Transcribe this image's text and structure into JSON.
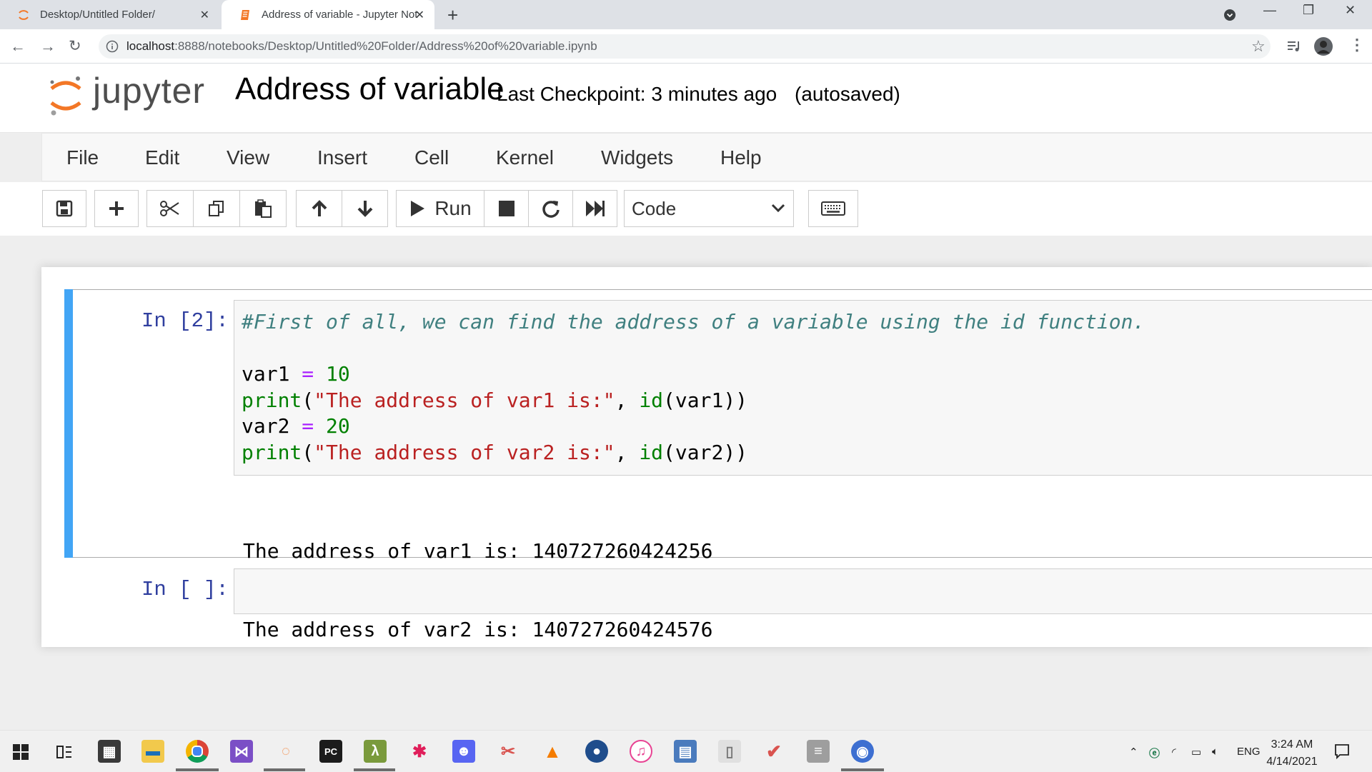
{
  "browser": {
    "tabs": [
      {
        "title": "Desktop/Untitled Folder/",
        "icon": "jupyter-spinner-icon",
        "active": false
      },
      {
        "title": "Address of variable - Jupyter Not",
        "icon": "notebook-icon",
        "active": true
      }
    ],
    "new_tab_label": "+",
    "url_host": "localhost",
    "url_path": ":8888/notebooks/Desktop/Untitled%20Folder/Address%20of%20variable.ipynb",
    "window_controls": {
      "minimize": "—",
      "restore": "❐",
      "close": "✕"
    }
  },
  "jupyter": {
    "logo_text": "jupyter",
    "notebook_title": "Address of variable",
    "checkpoint": "Last Checkpoint: 3 minutes ago",
    "autosave": "(autosaved)",
    "menu": [
      "File",
      "Edit",
      "View",
      "Insert",
      "Cell",
      "Kernel",
      "Widgets",
      "Help"
    ],
    "toolbar": {
      "run_label": "Run",
      "cell_type": "Code",
      "cell_type_options": [
        "Code"
      ]
    },
    "cells": [
      {
        "prompt": "In [2]:",
        "code_lines": [
          "#First of all, we can find the address of a variable using the id function.",
          "",
          "var1 = 10",
          "print(\"The address of var1 is:\", id(var1))",
          "var2 = 20",
          "print(\"The address of var2 is:\", id(var2))"
        ],
        "output_lines": [
          "The address of var1 is: 140727260424256",
          "The address of var2 is: 140727260424576"
        ]
      },
      {
        "prompt": "In [ ]:",
        "code_lines": [],
        "output_lines": []
      }
    ]
  },
  "taskbar": {
    "tray_lang": "ENG",
    "time": "3:24 AM",
    "date": "4/14/2021"
  },
  "colors": {
    "selected_cell_bar": "#42a5f5",
    "prompt": "#303f9f",
    "comment": "#408080",
    "string": "#ba2121",
    "builtin": "#008000",
    "jupyter_orange": "#f37726"
  }
}
